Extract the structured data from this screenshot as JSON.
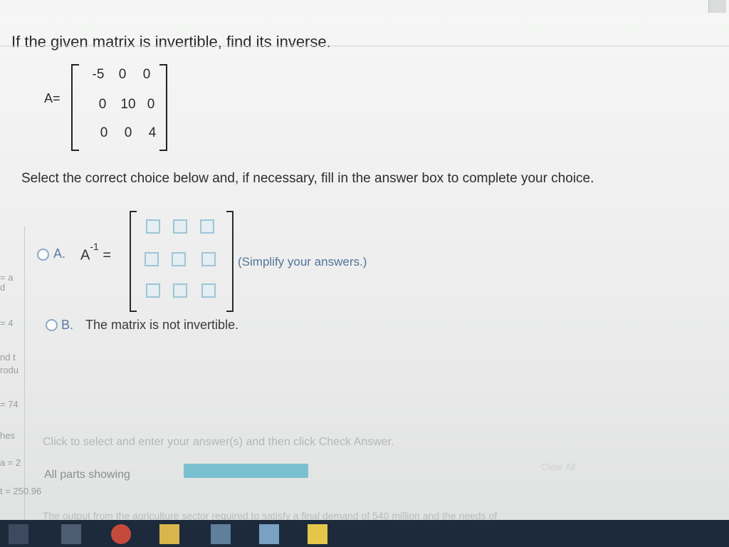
{
  "question": {
    "title": "If the given matrix is invertible, find its inverse.",
    "matrix_label": "A=",
    "matrix": [
      [
        "-5",
        "0",
        "0"
      ],
      [
        "0",
        "10",
        "0"
      ],
      [
        "0",
        "0",
        "4"
      ]
    ],
    "instruction": "Select the correct choice below and, if necessary, fill in the answer box to complete your choice."
  },
  "choices": {
    "a": {
      "letter": "A.",
      "expr_base": "A",
      "expr_sup": "-1",
      "equals": "=",
      "note": "(Simplify your answers.)"
    },
    "b": {
      "letter": "B.",
      "text": "The matrix is not invertible."
    }
  },
  "footer": {
    "help": "Click to select and enter your answer(s) and then click Check Answer.",
    "parts": "All parts showing",
    "clear": "Clear All",
    "bottom_text": "The output from the agriculture sector required to satisfy a final demand of 540 million and the needs of",
    "progress_fraction": 1.0
  },
  "left_labels": [
    "d",
    "= 4",
    "nd t",
    "rodu",
    "= 74",
    "hes",
    "a = 2",
    "t = 250.96",
    "= a"
  ],
  "colors": {
    "accent": "#7ac0d0",
    "radio": "#8fa9c8",
    "taskbar": "#1c2a3c"
  }
}
